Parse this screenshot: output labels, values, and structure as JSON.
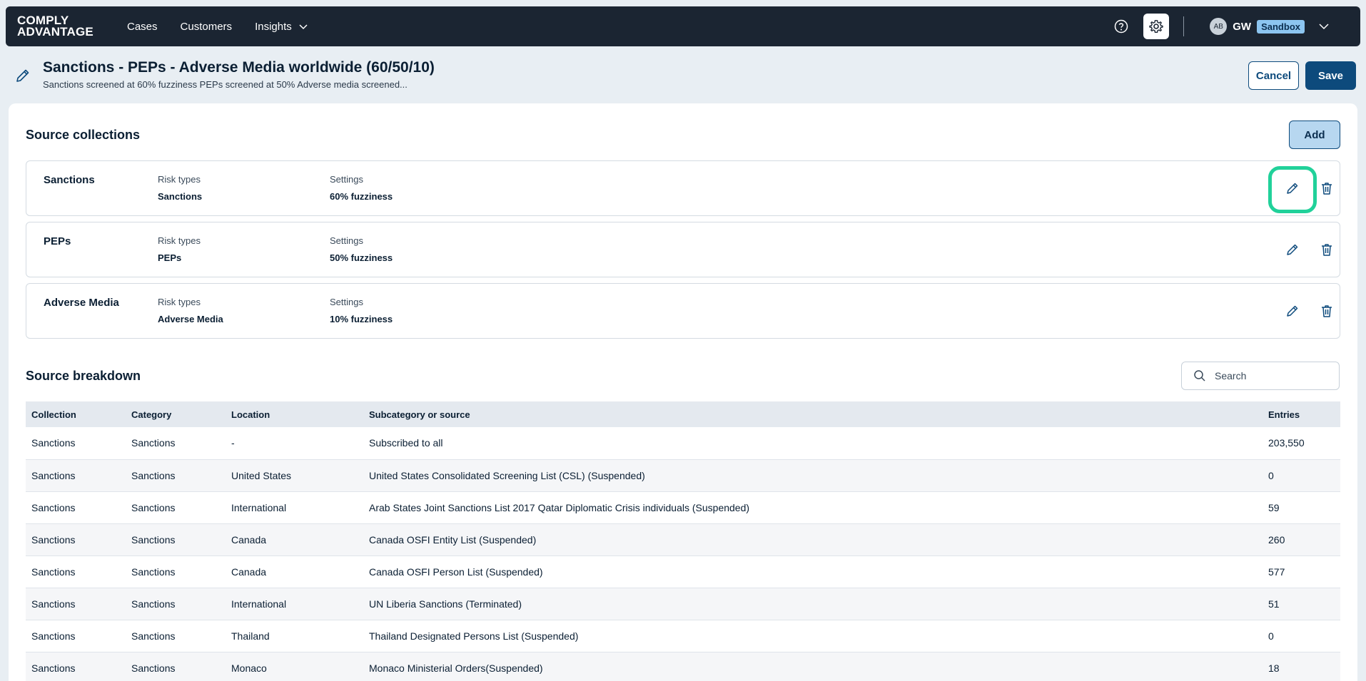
{
  "nav": {
    "logo_line1": "COMPLY",
    "logo_line2": "ADVANTAGE",
    "items": [
      {
        "label": "Cases"
      },
      {
        "label": "Customers"
      },
      {
        "label": "Insights"
      }
    ],
    "avatar": "AB",
    "user_initials": "GW",
    "env_badge": "Sandbox"
  },
  "header": {
    "title": "Sanctions - PEPs - Adverse Media worldwide (60/50/10)",
    "subtitle": "Sanctions screened at 60% fuzziness PEPs screened at 50% Adverse media screened...",
    "cancel_label": "Cancel",
    "save_label": "Save"
  },
  "collections": {
    "title": "Source collections",
    "add_label": "Add",
    "risk_types_label": "Risk types",
    "settings_label": "Settings",
    "items": [
      {
        "name": "Sanctions",
        "risk_type": "Sanctions",
        "setting": "60% fuzziness"
      },
      {
        "name": "PEPs",
        "risk_type": "PEPs",
        "setting": "50% fuzziness"
      },
      {
        "name": "Adverse Media",
        "risk_type": "Adverse Media",
        "setting": "10% fuzziness"
      }
    ]
  },
  "breakdown": {
    "title": "Source breakdown",
    "search_placeholder": "Search",
    "columns": [
      "Collection",
      "Category",
      "Location",
      "Subcategory or source",
      "Entries"
    ],
    "rows": [
      [
        "Sanctions",
        "Sanctions",
        "-",
        "Subscribed to all",
        "203,550"
      ],
      [
        "Sanctions",
        "Sanctions",
        "United States",
        "United States Consolidated Screening List (CSL) (Suspended)",
        "0"
      ],
      [
        "Sanctions",
        "Sanctions",
        "International",
        "Arab States Joint Sanctions List 2017 Qatar Diplomatic Crisis individuals (Suspended)",
        "59"
      ],
      [
        "Sanctions",
        "Sanctions",
        "Canada",
        "Canada OSFI Entity List (Suspended)",
        "260"
      ],
      [
        "Sanctions",
        "Sanctions",
        "Canada",
        "Canada OSFI Person List (Suspended)",
        "577"
      ],
      [
        "Sanctions",
        "Sanctions",
        "International",
        "UN Liberia Sanctions (Terminated)",
        "51"
      ],
      [
        "Sanctions",
        "Sanctions",
        "Thailand",
        "Thailand Designated Persons List (Suspended)",
        "0"
      ],
      [
        "Sanctions",
        "Sanctions",
        "Monaco",
        "Monaco Ministerial Orders(Suspended)",
        "18"
      ]
    ]
  },
  "colors": {
    "nav_bg": "#1b2532",
    "primary": "#0d4a7c",
    "badge_bg": "#8cc5f0",
    "highlight": "#21d19a",
    "page_bg": "#e8eef3"
  },
  "icons": [
    "chevron-down-icon",
    "help-icon",
    "gear-icon",
    "pencil-icon",
    "trash-icon",
    "search-icon"
  ]
}
